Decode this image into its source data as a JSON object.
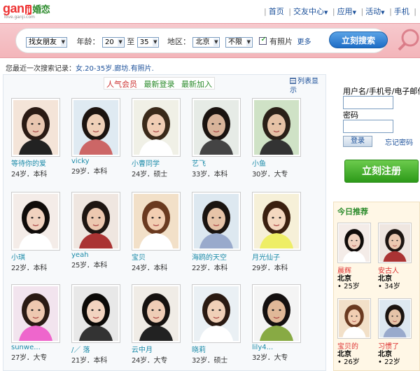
{
  "header": {
    "logo_text": "ganji婚恋",
    "logo_sub": "love.ganji.com",
    "nav": [
      "首页",
      "交友中心",
      "应用",
      "活动",
      "手机"
    ]
  },
  "search": {
    "seeking": "找女朋友",
    "age_label": "年龄：",
    "age_from": "20",
    "age_to_label": "至",
    "age_to": "35",
    "region_label": "地区：",
    "city": "北京",
    "district": "不限",
    "photo_label": "有照片",
    "photo_checked": true,
    "more": "更多",
    "button": "立刻搜索"
  },
  "recent": {
    "label": "您最近一次搜索记录：",
    "value": "女.20-35岁.廊坊.有照片."
  },
  "tabs": [
    "人气会员",
    "最新登录",
    "最新加入"
  ],
  "list_view": "列表显示",
  "members": [
    {
      "name": "等待你的爱",
      "age": "24岁",
      "edu": "本科"
    },
    {
      "name": "vicky",
      "age": "29岁",
      "edu": "本科"
    },
    {
      "name": "小曹同学",
      "age": "24岁",
      "edu": "硕士"
    },
    {
      "name": "艺飞",
      "age": "33岁",
      "edu": "本科"
    },
    {
      "name": "小鱼",
      "age": "30岁",
      "edu": "大专"
    },
    {
      "name": "小琪",
      "age": "22岁",
      "edu": "本科"
    },
    {
      "name": "yeah",
      "age": "25岁",
      "edu": "本科"
    },
    {
      "name": "宝贝",
      "age": "24岁",
      "edu": "本科"
    },
    {
      "name": "海鸥的天空",
      "age": "22岁",
      "edu": "本科"
    },
    {
      "name": "月光仙子",
      "age": "29岁",
      "edu": "本科"
    },
    {
      "name": "sunwe...",
      "age": "27岁",
      "edu": "大专"
    },
    {
      "name": "/／ 落",
      "age": "21岁",
      "edu": "本科"
    },
    {
      "name": "云中月",
      "age": "24岁",
      "edu": "大专"
    },
    {
      "name": "晓莉",
      "age": "32岁",
      "edu": "硕士"
    },
    {
      "name": "lily4...",
      "age": "32岁",
      "edu": "大专"
    }
  ],
  "login": {
    "user_label": "用户名/手机号/电子邮件",
    "pass_label": "密码",
    "login_button": "登录",
    "forgot": "忘记密码",
    "register": "立刻注册"
  },
  "today": {
    "title": "今日推荐",
    "items": [
      {
        "name": "晨辉",
        "city": "北京",
        "age": "25岁"
      },
      {
        "name": "安古人",
        "city": "北京",
        "age": "34岁"
      },
      {
        "name": "宝贝的",
        "city": "北京",
        "age": "26岁"
      },
      {
        "name": "习惯了",
        "city": "北京",
        "age": "22岁"
      }
    ]
  },
  "colors": {
    "brand_red": "#dd2222",
    "link_blue": "#1a4f99",
    "search_pink": "#f3b5ba",
    "register_green": "#2d9a19"
  }
}
